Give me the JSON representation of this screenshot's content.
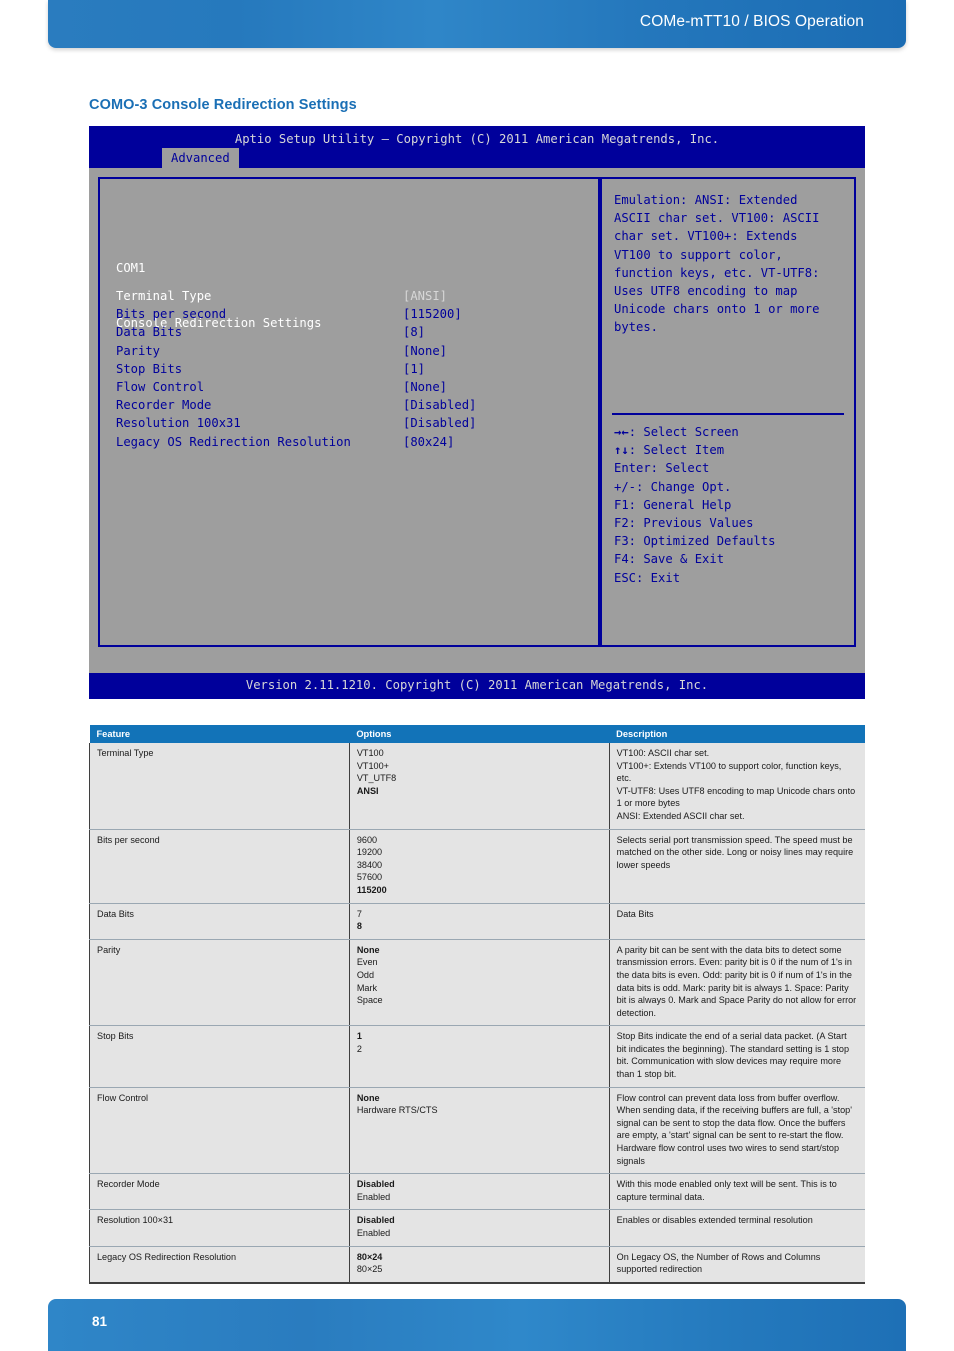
{
  "header": {
    "title": "COMe-mTT10 / BIOS Operation"
  },
  "section": {
    "title": "COMO-3 Console Redirection Settings"
  },
  "bios": {
    "titlebar": "Aptio Setup Utility – Copyright (C) 2011 American Megatrends, Inc.",
    "tab": "Advanced",
    "heading_line1": "COM1",
    "heading_line2": "Console Redirection Settings",
    "items": [
      {
        "label": "Terminal Type",
        "value": "[ANSI]",
        "selected": true
      },
      {
        "label": "Bits per second",
        "value": "[115200]",
        "selected": false
      },
      {
        "label": "Data Bits",
        "value": "[8]",
        "selected": false
      },
      {
        "label": "Parity",
        "value": "[None]",
        "selected": false
      },
      {
        "label": "Stop Bits",
        "value": "[1]",
        "selected": false
      },
      {
        "label": "Flow Control",
        "value": "[None]",
        "selected": false
      },
      {
        "label": "Recorder Mode",
        "value": "[Disabled]",
        "selected": false
      },
      {
        "label": "Resolution 100x31",
        "value": "[Disabled]",
        "selected": false
      },
      {
        "label": "Legacy OS Redirection Resolution",
        "value": "[80x24]",
        "selected": false
      }
    ],
    "help_lines": [
      "Emulation: ANSI: Extended",
      "ASCII char set. VT100: ASCII",
      "char set. VT100+: Extends",
      "VT100 to support color,",
      "function keys, etc. VT-UTF8:",
      "Uses UTF8 encoding to map",
      "Unicode chars onto 1 or more",
      "bytes."
    ],
    "keys": [
      {
        "glyph": "→←",
        "text": ": Select Screen"
      },
      {
        "glyph": "↑↓",
        "text": ": Select Item"
      },
      {
        "glyph": "",
        "text": "Enter: Select"
      },
      {
        "glyph": "",
        "text": "+/-: Change Opt."
      },
      {
        "glyph": "",
        "text": "F1: General Help"
      },
      {
        "glyph": "",
        "text": "F2: Previous Values"
      },
      {
        "glyph": "",
        "text": "F3: Optimized Defaults"
      },
      {
        "glyph": "",
        "text": "F4: Save & Exit"
      },
      {
        "glyph": "",
        "text": "ESC: Exit"
      }
    ],
    "footer": "Version 2.11.1210. Copyright (C) 2011 American Megatrends, Inc."
  },
  "table": {
    "columns": [
      "Feature",
      "Options",
      "Description"
    ],
    "rows": [
      {
        "feature": "Terminal Type",
        "options": [
          {
            "text": "VT100",
            "bold": false
          },
          {
            "text": "VT100+",
            "bold": false
          },
          {
            "text": "VT_UTF8",
            "bold": false
          },
          {
            "text": "ANSI",
            "bold": true
          }
        ],
        "description": "VT100: ASCII char set.\nVT100+: Extends VT100 to support color, function keys, etc.\nVT-UTF8: Uses UTF8 encoding to map Unicode chars onto 1 or more bytes\nANSI: Extended ASCII char set."
      },
      {
        "feature": "Bits per second",
        "options": [
          {
            "text": "9600",
            "bold": false
          },
          {
            "text": "19200",
            "bold": false
          },
          {
            "text": "38400",
            "bold": false
          },
          {
            "text": "57600",
            "bold": false
          },
          {
            "text": "115200",
            "bold": true
          }
        ],
        "description": "Selects serial port transmission speed. The speed must be matched on the other side. Long or noisy lines may require lower speeds"
      },
      {
        "feature": "Data Bits",
        "options": [
          {
            "text": "7",
            "bold": false
          },
          {
            "text": "8",
            "bold": true
          }
        ],
        "description": "Data Bits"
      },
      {
        "feature": "Parity",
        "options": [
          {
            "text": "None",
            "bold": true
          },
          {
            "text": "Even",
            "bold": false
          },
          {
            "text": "Odd",
            "bold": false
          },
          {
            "text": "Mark",
            "bold": false
          },
          {
            "text": "Space",
            "bold": false
          }
        ],
        "description": "A parity bit can be sent with the data bits to detect some transmission errors. Even: parity bit is 0 if the num of 1's in the data bits is even. Odd: parity bit is 0 if num of 1's in the data bits is odd. Mark: parity bit is always 1. Space: Parity bit is always 0. Mark and Space Parity do not allow for error detection."
      },
      {
        "feature": "Stop Bits",
        "options": [
          {
            "text": "1",
            "bold": true
          },
          {
            "text": "2",
            "bold": false
          }
        ],
        "description": "Stop Bits indicate the end of a serial data packet. (A Start bit indicates the beginning). The standard setting is 1 stop bit. Communication with slow devices may require more than 1 stop bit."
      },
      {
        "feature": "Flow Control",
        "options": [
          {
            "text": "None",
            "bold": true
          },
          {
            "text": "Hardware RTS/CTS",
            "bold": false
          }
        ],
        "description": "Flow control can prevent data loss from buffer overflow. When sending data, if the receiving buffers are full, a 'stop' signal can be sent to stop the data flow. Once the buffers are empty, a 'start' signal can be sent to re-start the flow. Hardware flow control uses two wires to send start/stop signals"
      },
      {
        "feature": "Recorder Mode",
        "options": [
          {
            "text": "Disabled",
            "bold": true
          },
          {
            "text": "Enabled",
            "bold": false
          }
        ],
        "description": "With this mode enabled only text will be sent. This is to capture terminal data."
      },
      {
        "feature": "Resolution 100×31",
        "options": [
          {
            "text": "Disabled",
            "bold": true
          },
          {
            "text": "Enabled",
            "bold": false
          }
        ],
        "description": "Enables or disables extended terminal resolution"
      },
      {
        "feature": "Legacy OS Redirection Resolution",
        "options": [
          {
            "text": "80×24",
            "bold": true
          },
          {
            "text": "80×25",
            "bold": false
          }
        ],
        "description": "On Legacy OS, the Number of Rows and Columns supported redirection"
      }
    ]
  },
  "footer": {
    "page_number": "81"
  }
}
